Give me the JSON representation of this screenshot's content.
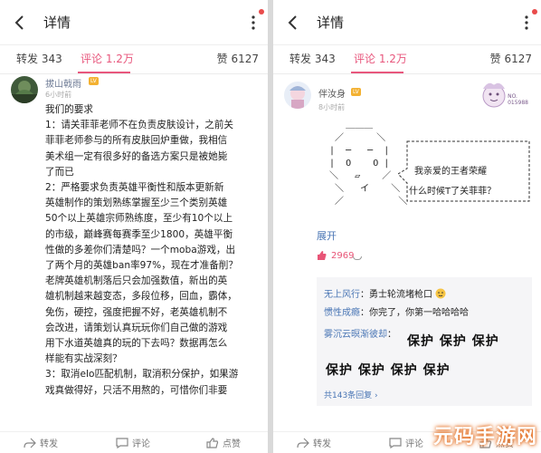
{
  "colors": {
    "accent": "#e8577d",
    "link": "#4a76b5"
  },
  "left": {
    "header": {
      "title": "详情"
    },
    "tabs": {
      "forward": "转发 343",
      "comment": "评论 1.2万",
      "like": "赞 6127"
    },
    "post": {
      "user": "拔山戟雨",
      "badge": "LV",
      "time": "6小时前",
      "lines": [
        "我们的要求",
        "1：请关菲菲老师不在负责皮肤设计，之前关",
        "菲菲老师参与的所有皮肤回炉重做，我相信",
        "美术组一定有很多好的备选方案只是被她毙",
        "了而已",
        "2：严格要求负责英雄平衡性和版本更新新",
        "英雄制作的策划熟练掌握至少三个类别英雄",
        "50个以上英雄宗师熟练度，至少有10个以上",
        "的市级，巅峰赛每赛季至少1800，英雄平衡",
        "性做的多差你们清楚吗？一个moba游戏，出",
        "了两个月的英雄ban率97%，现在才准备削？",
        "老牌英雄机制落后只会加强数值，新出的英",
        "雄机制越来越变态，多段位移，回血，霸体，",
        "免伤，硬控，强度把握不好，老英雄机制不",
        "会改进，请策划认真玩玩你们自己做的游戏",
        "用下水道英雄真的玩的下去吗？数据再怎么",
        "样能有实战深刻？",
        "3：取消elo匹配机制，取消积分保护，如果游",
        "戏真做得好，只活不用熬的，可惜你们非要"
      ]
    },
    "footer": {
      "forward": "转发",
      "comment": "评论",
      "like": "点赞"
    }
  },
  "right": {
    "header": {
      "title": "详情"
    },
    "tabs": {
      "forward": "转发 343",
      "comment": "评论 1.2万",
      "like": "赞 6127"
    },
    "post": {
      "user": "伴汝身",
      "badge": "LV",
      "time": "8小时前",
      "sticker_text": [
        "NO.",
        "015988"
      ],
      "ascii_lines": [
        "     ＿＿＿",
        "   ／      ＼",
        "  |  ─   ─  |",
        "  |  O    O |",
        "  ＼   ▱    ／",
        "   ＼   イ    ＼",
        "   ／          ＼"
      ],
      "speech": [
        "我亲爱的王者荣耀",
        "什么时候T了关菲菲？"
      ],
      "expand": "展开",
      "likes": "2969"
    },
    "sub_comments": [
      {
        "name": "无上风行",
        "text": "：勇士轮流堵枪口"
      },
      {
        "name": "惯性成瘾",
        "text": "：你完了，你第一哈哈哈哈"
      },
      {
        "name": "雾沉云暝渐彼却",
        "text": "："
      }
    ],
    "protect_rows": [
      "保护 保护 保护",
      "保护 保护 保护 保护"
    ],
    "reply_count": "共143条回复 ›",
    "footer": {
      "forward": "转发",
      "comment": "评论",
      "like": "点赞"
    }
  },
  "watermark": "元码手游网"
}
